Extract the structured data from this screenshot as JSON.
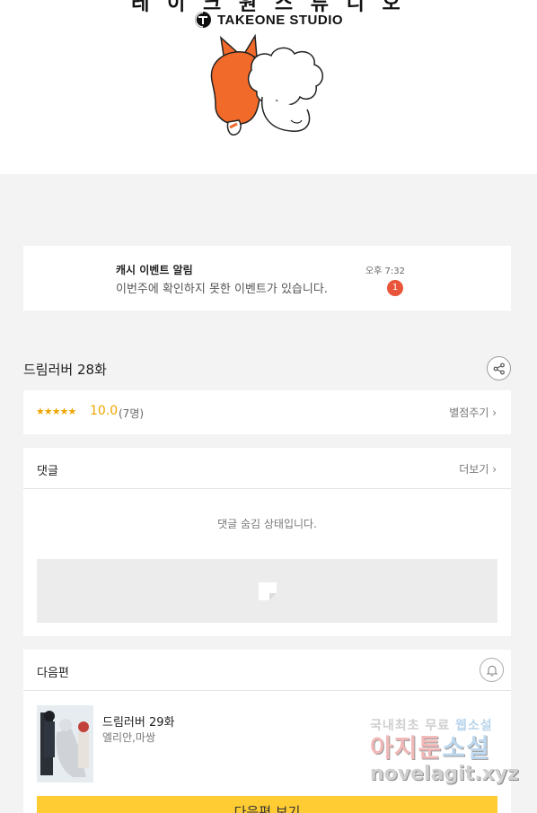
{
  "banner": {
    "studio_korean": "레 이 크 원 스 튜 디 오",
    "studio_name": "TAKEONE STUDIO"
  },
  "notice": {
    "title": "캐시 이벤트 알림",
    "body": "이번주에 확인하지 못한 이벤트가 있습니다.",
    "time": "오후 7:32",
    "badge": "1"
  },
  "episode": {
    "title": "드림러버 28화"
  },
  "rating": {
    "stars": "★★★★★",
    "score": "10.0",
    "votes": "(7명)",
    "rate_label": "별점주기 ›"
  },
  "comments": {
    "label": "댓글",
    "more_label": "더보기 ›",
    "hidden_text": "댓글 숨김 상태입니다."
  },
  "next_episode": {
    "section_label": "다음편",
    "title": "드림러버 29화",
    "author": "엘리안,마쌍",
    "cta": "다음편 보기"
  },
  "watermark": {
    "line1_a": "국내최초 무료",
    "line1_b": "웹소설",
    "line2_a": "아지툰",
    "line2_b": "소설",
    "line3": "novelagit.xyz"
  },
  "colors": {
    "accent_star": "#f0a400",
    "badge": "#e8553a",
    "cta": "#ffcc33",
    "mascot": "#f26a2a"
  }
}
